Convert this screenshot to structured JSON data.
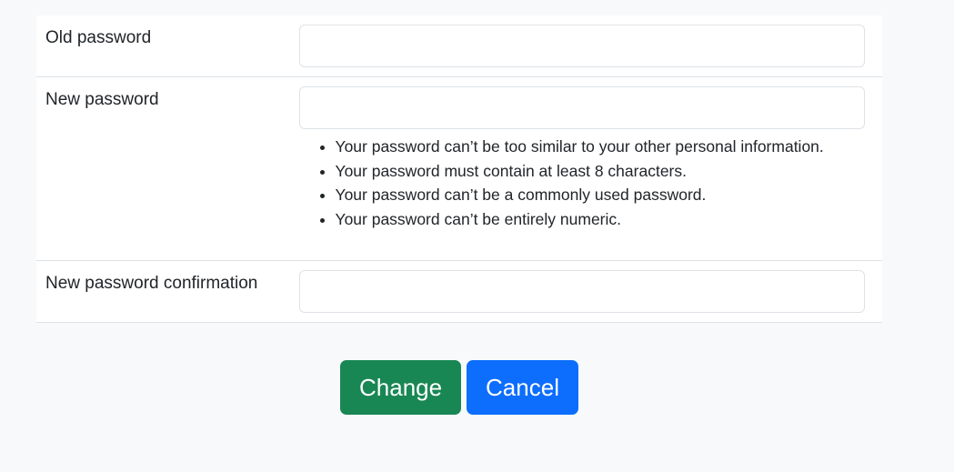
{
  "form": {
    "fields": [
      {
        "label": "Old password",
        "value": ""
      },
      {
        "label": "New password",
        "value": ""
      },
      {
        "label": "New password confirmation",
        "value": ""
      }
    ],
    "help_text": [
      "Your password can’t be too similar to your other personal information.",
      "Your password must contain at least 8 characters.",
      "Your password can’t be a commonly used password.",
      "Your password can’t be entirely numeric."
    ]
  },
  "actions": {
    "change_label": "Change",
    "cancel_label": "Cancel"
  },
  "colors": {
    "change_button": "#198754",
    "cancel_button": "#0d6efd",
    "page_background": "#f8f9fa"
  }
}
